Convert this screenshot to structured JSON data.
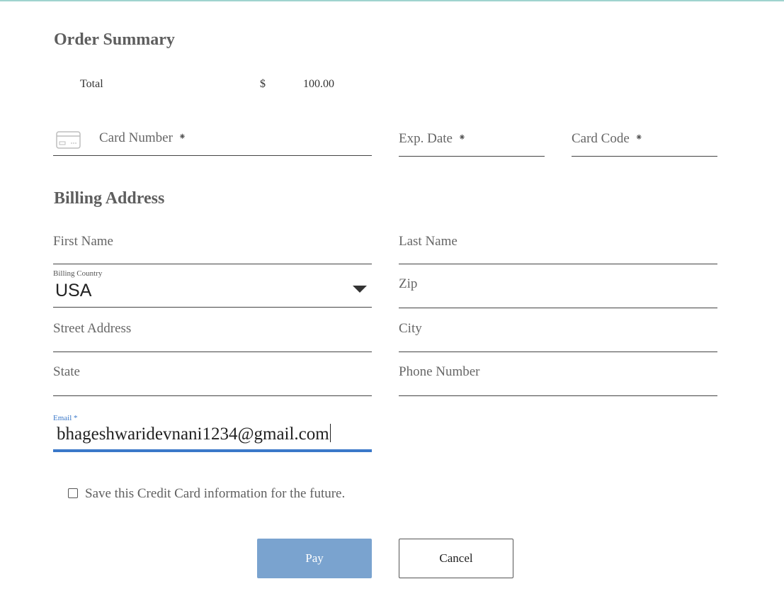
{
  "order_summary": {
    "heading": "Order Summary",
    "total_label": "Total",
    "currency": "$",
    "amount": "100.00"
  },
  "payment": {
    "card_icon": "credit-card-icon",
    "card_number": {
      "placeholder": "Card Number",
      "required_mark": "⁕"
    },
    "exp_date": {
      "placeholder": "Exp. Date",
      "required_mark": "⁕"
    },
    "card_code": {
      "placeholder": "Card Code",
      "required_mark": "⁕"
    }
  },
  "billing": {
    "heading": "Billing Address",
    "first_name": "First Name",
    "last_name": "Last Name",
    "country_label": "Billing Country",
    "country_value": "USA",
    "zip": "Zip",
    "street": "Street Address",
    "city": "City",
    "state": "State",
    "phone": "Phone Number",
    "email_label": "Email",
    "email_required_mark": "*",
    "email_value": "bhageshwaridevnani1234@gmail.com"
  },
  "save_card": {
    "label": "Save this Credit Card information for the future.",
    "checked": false
  },
  "actions": {
    "pay_label": "Pay",
    "cancel_label": "Cancel"
  },
  "colors": {
    "accent": "#3a78c9",
    "pay_button": "#7aa3cf",
    "top_border": "#9fd3cf"
  }
}
